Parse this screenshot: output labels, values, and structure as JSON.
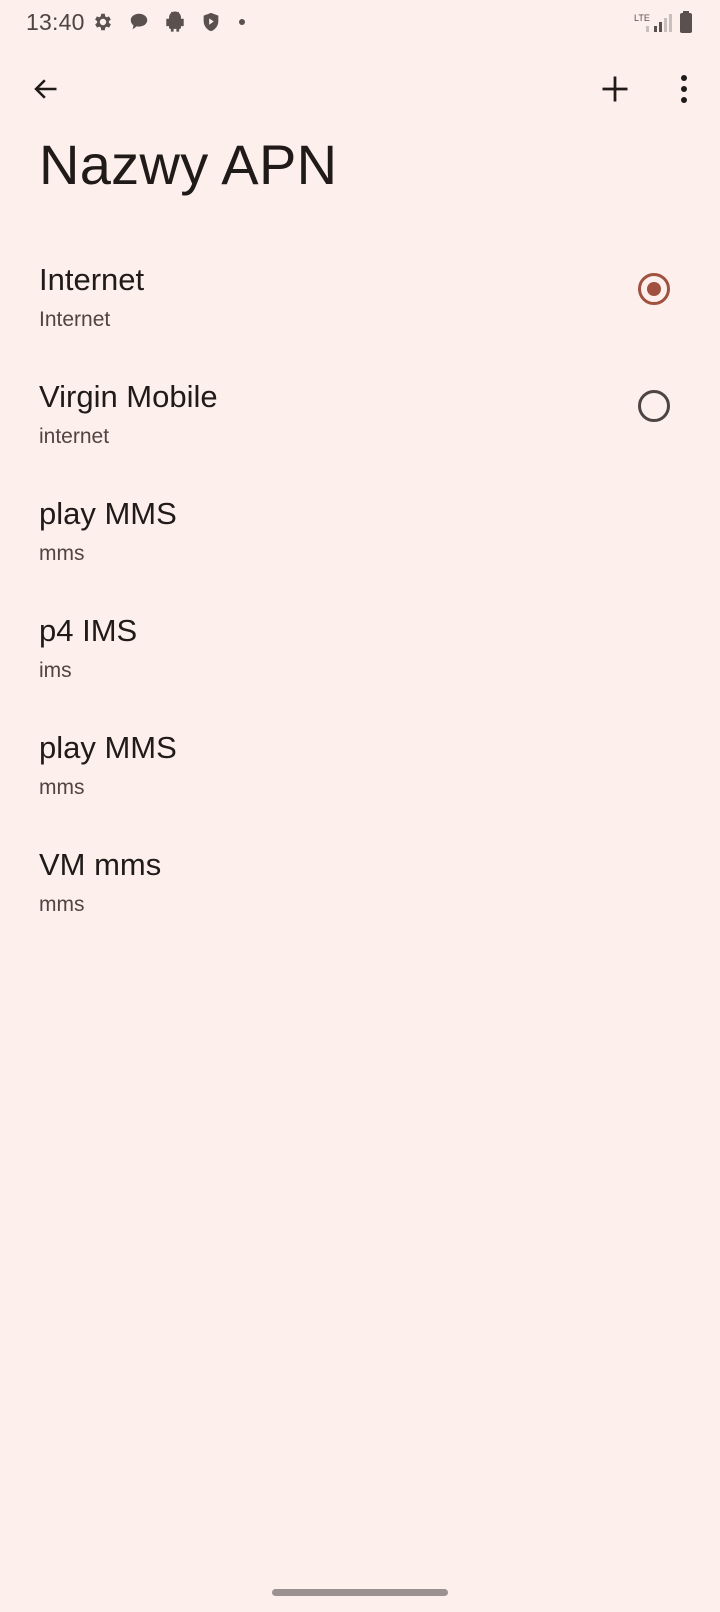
{
  "status_bar": {
    "time": "13:40",
    "network_label": "LTE",
    "icons": [
      "settings-icon",
      "chat-bubble-icon",
      "android-icon",
      "play-protect-icon",
      "notification-dot-icon",
      "lte-signal-icon",
      "battery-icon"
    ]
  },
  "toolbar": {
    "back_icon": "arrow-back-icon",
    "add_icon": "plus-icon",
    "more_icon": "more-vert-icon"
  },
  "page": {
    "title": "Nazwy APN"
  },
  "apn_list": [
    {
      "name": "Internet",
      "apn": "Internet",
      "has_radio": true,
      "selected": true
    },
    {
      "name": "Virgin Mobile",
      "apn": "internet",
      "has_radio": true,
      "selected": false
    },
    {
      "name": "play MMS",
      "apn": "mms",
      "has_radio": false,
      "selected": false
    },
    {
      "name": "p4 IMS",
      "apn": "ims",
      "has_radio": false,
      "selected": false
    },
    {
      "name": "play MMS",
      "apn": "mms",
      "has_radio": false,
      "selected": false
    },
    {
      "name": "VM mms",
      "apn": "mms",
      "has_radio": false,
      "selected": false
    }
  ],
  "colors": {
    "background": "#fdefec",
    "accent": "#a0513f",
    "text_primary": "#201a19",
    "text_secondary": "#534341"
  }
}
